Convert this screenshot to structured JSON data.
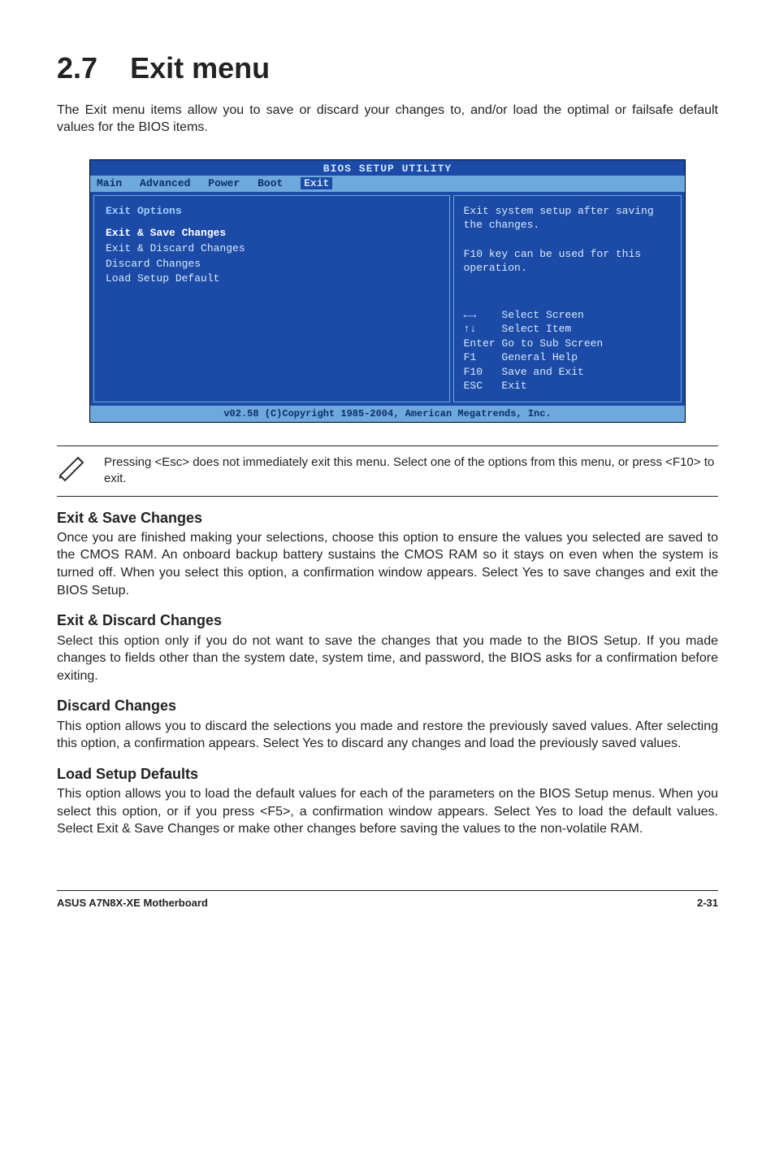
{
  "section": {
    "number": "2.7",
    "title": "Exit menu"
  },
  "intro": "The Exit menu items allow you to save or discard your changes to, and/or load the optimal or failsafe default values for the BIOS items.",
  "bios": {
    "title": "BIOS SETUP UTILITY",
    "menubar": [
      "Main",
      "Advanced",
      "Power",
      "Boot",
      "Exit"
    ],
    "active_tab": "Exit",
    "left": {
      "heading": "Exit Options",
      "items": [
        "Exit & Save Changes",
        "Exit & Discard Changes",
        "Discard Changes",
        "",
        "Load Setup Default"
      ],
      "selected_index": 0
    },
    "right_top": "Exit system setup after saving the changes.\n\nF10 key can be used for this operation.",
    "right_keys": [
      "←→    Select Screen",
      "↑↓    Select Item",
      "Enter Go to Sub Screen",
      "F1    General Help",
      "F10   Save and Exit",
      "ESC   Exit"
    ],
    "footer": "v02.58 (C)Copyright 1985-2004, American Megatrends, Inc."
  },
  "note": "Pressing <Esc> does not immediately exit this menu. Select one of the options from this menu, or press <F10> to exit.",
  "subs": [
    {
      "title": "Exit & Save Changes",
      "body": "Once you are finished making your selections, choose this option to ensure the values you selected are saved to the CMOS RAM. An onboard backup battery sustains the CMOS RAM so it stays on even when the system is turned off. When you select this option, a confirmation window appears. Select Yes to save changes and exit the BIOS Setup."
    },
    {
      "title": "Exit & Discard Changes",
      "body": "Select this option only if you do not want to save the changes that you  made to the BIOS Setup. If you made changes to fields other than the system date, system time, and password, the BIOS asks for a confirmation before exiting."
    },
    {
      "title": "Discard Changes",
      "body": "This option allows you to discard the selections you made and restore the previously saved values. After selecting this option, a confirmation appears. Select Yes to discard any changes and load the previously saved values."
    },
    {
      "title": "Load Setup Defaults",
      "body": "This option allows you to load the default values for each of the parameters on the BIOS Setup menus. When you select this option, or if you press <F5>, a confirmation window appears. Select Yes to load the default values. Select Exit & Save Changes or make other changes before saving the values to the non-volatile RAM."
    }
  ],
  "footer": {
    "left": "ASUS A7N8X-XE Motherboard",
    "right": "2-31"
  }
}
